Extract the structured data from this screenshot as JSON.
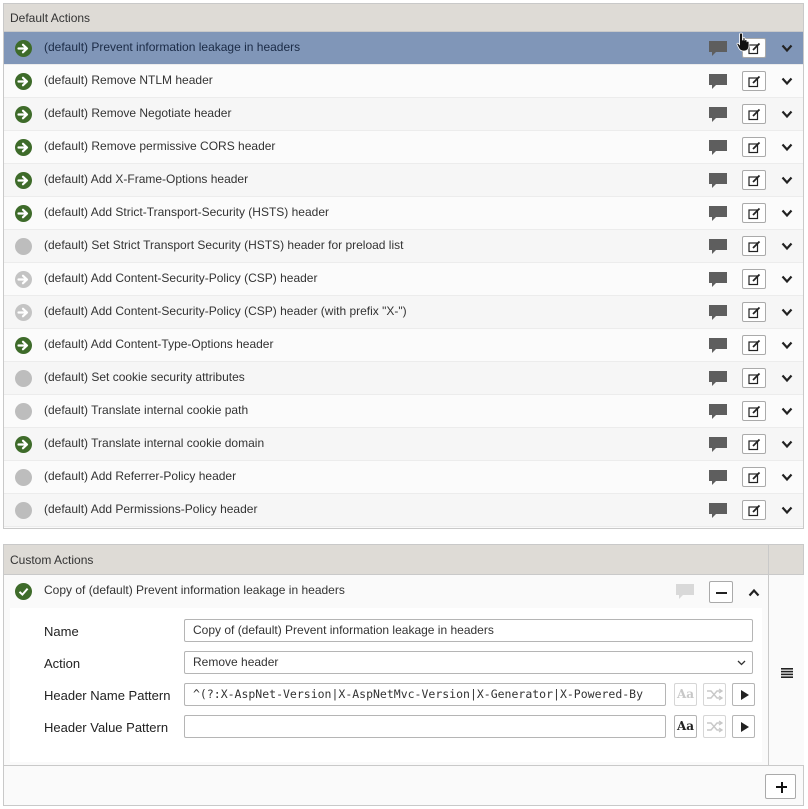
{
  "default_actions": {
    "title": "Default Actions",
    "rows": [
      {
        "label": "(default) Prevent information leakage in headers",
        "status": "active"
      },
      {
        "label": "(default) Remove NTLM header",
        "status": "active"
      },
      {
        "label": "(default) Remove Negotiate header",
        "status": "active"
      },
      {
        "label": "(default) Remove permissive CORS header",
        "status": "active"
      },
      {
        "label": "(default) Add X-Frame-Options header",
        "status": "active"
      },
      {
        "label": "(default) Add Strict-Transport-Security (HSTS) header",
        "status": "active"
      },
      {
        "label": "(default) Set Strict Transport Security (HSTS) header for preload list",
        "status": "inactive"
      },
      {
        "label": "(default) Add Content-Security-Policy (CSP) header",
        "status": "arrow-gray"
      },
      {
        "label": "(default) Add Content-Security-Policy (CSP) header (with prefix \"X-\")",
        "status": "arrow-gray"
      },
      {
        "label": "(default) Add Content-Type-Options header",
        "status": "active"
      },
      {
        "label": "(default) Set cookie security attributes",
        "status": "inactive"
      },
      {
        "label": "(default) Translate internal cookie path",
        "status": "inactive"
      },
      {
        "label": "(default) Translate internal cookie domain",
        "status": "active"
      },
      {
        "label": "(default) Add Referrer-Policy header",
        "status": "inactive"
      },
      {
        "label": "(default) Add Permissions-Policy header",
        "status": "inactive"
      }
    ],
    "selected_index": 0
  },
  "custom_actions": {
    "title": "Custom Actions",
    "item": {
      "label": "Copy of (default) Prevent information leakage in headers",
      "status": "ok"
    },
    "form": {
      "name_label": "Name",
      "name_value": "Copy of (default) Prevent information leakage in headers",
      "action_label": "Action",
      "action_value": "Remove header",
      "header_name_label": "Header Name Pattern",
      "header_name_value": "^(?:X-AspNet-Version|X-AspNetMvc-Version|X-Generator|X-Powered-By",
      "header_value_label": "Header Value Pattern",
      "header_value_value": "",
      "case_button": "Aa"
    }
  },
  "colors": {
    "selected_row": "#8096b8",
    "active_status": "#3e6b2a",
    "inactive_status": "#bdbdbd",
    "panel_header": "#dedbd6"
  }
}
